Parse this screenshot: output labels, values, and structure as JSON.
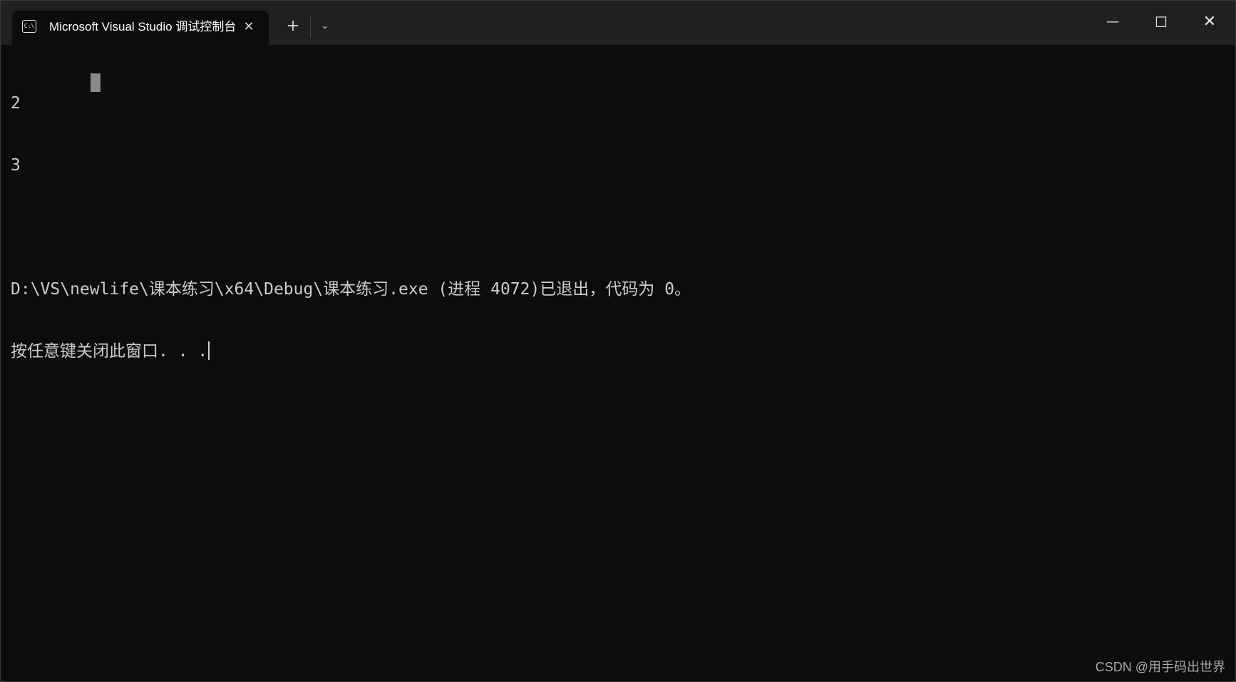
{
  "titlebar": {
    "tab_icon_text": "C:\\",
    "tab_title": "Microsoft Visual Studio 调试控制台",
    "tab_close_glyph": "✕",
    "new_tab_glyph": "+",
    "dropdown_glyph": "⌄",
    "minimize_glyph": "—",
    "maximize_glyph": "☐",
    "close_glyph": "✕"
  },
  "terminal": {
    "lines": [
      "2",
      "3",
      "",
      "D:\\VS\\newlife\\课本练习\\x64\\Debug\\课本练习.exe (进程 4072)已退出，代码为 0。",
      "按任意键关闭此窗口. . ."
    ]
  },
  "watermark": "CSDN @用手码出世界",
  "colors": {
    "background": "#0c0c0c",
    "titlebar": "#202020",
    "text": "#cccccc"
  }
}
